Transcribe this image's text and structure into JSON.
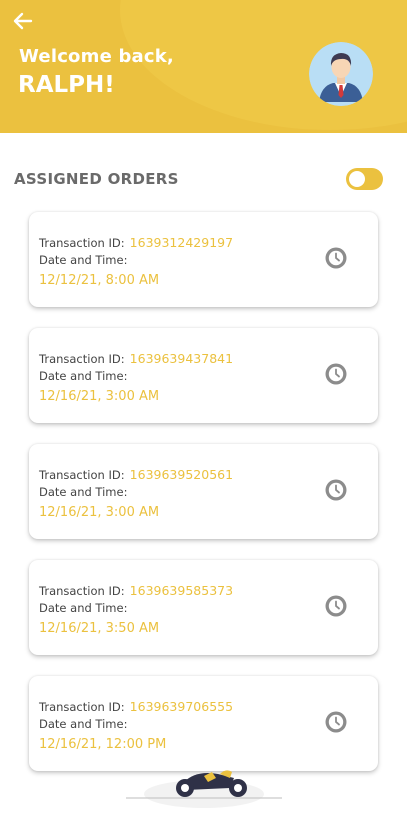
{
  "header": {
    "back_icon": "arrow-left-icon",
    "welcome": "Welcome back,",
    "username": "RALPH!",
    "avatar_icon": "user-avatar",
    "accent": "#ebc13f"
  },
  "section": {
    "title": "ASSIGNED ORDERS",
    "toggle_on": true
  },
  "orders": [
    {
      "tx_label": "Transaction ID:",
      "tx_id": "1639312429197",
      "dt_label": "Date and Time:",
      "datetime": "12/12/21, 8:00 AM",
      "icon": "timer-icon"
    },
    {
      "tx_label": "Transaction ID:",
      "tx_id": "1639639437841",
      "dt_label": "Date and Time:",
      "datetime": "12/16/21, 3:00 AM",
      "icon": "timer-icon"
    },
    {
      "tx_label": "Transaction ID:",
      "tx_id": "1639639520561",
      "dt_label": "Date and Time:",
      "datetime": "12/16/21, 3:00 AM",
      "icon": "timer-icon"
    },
    {
      "tx_label": "Transaction ID:",
      "tx_id": "1639639585373",
      "dt_label": "Date and Time:",
      "datetime": "12/16/21, 3:50 AM",
      "icon": "timer-icon"
    },
    {
      "tx_label": "Transaction ID:",
      "tx_id": "1639639706555",
      "dt_label": "Date and Time:",
      "datetime": "12/16/21, 12:00 PM",
      "icon": "timer-icon"
    }
  ]
}
